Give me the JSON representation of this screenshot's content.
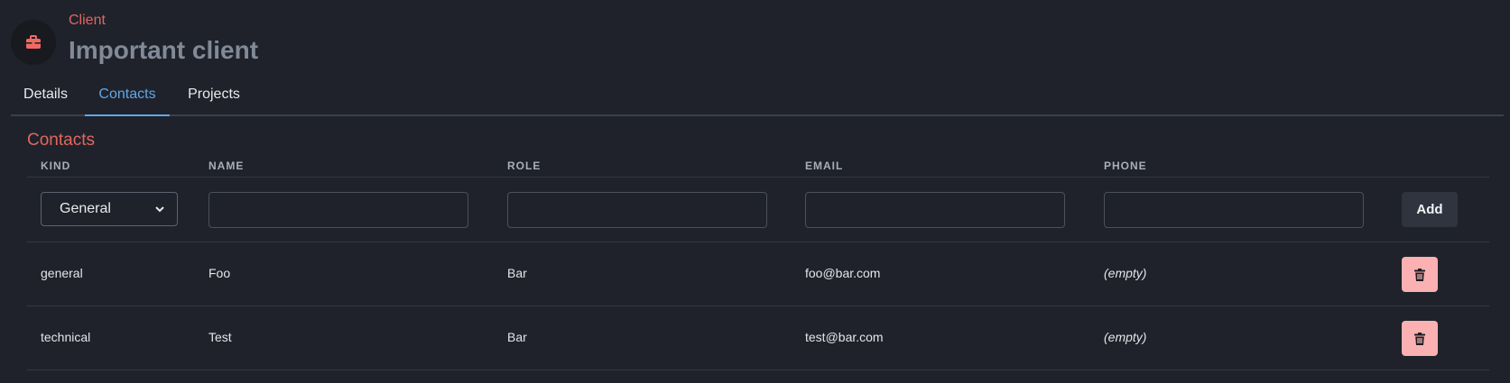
{
  "header": {
    "eyebrow": "Client",
    "title": "Important client",
    "icon": "briefcase-icon"
  },
  "tabs": [
    {
      "label": "Details",
      "active": false
    },
    {
      "label": "Contacts",
      "active": true
    },
    {
      "label": "Projects",
      "active": false
    }
  ],
  "section_title": "Contacts",
  "columns": [
    "KIND",
    "NAME",
    "ROLE",
    "EMAIL",
    "PHONE"
  ],
  "form": {
    "kind_selected": "General",
    "name_value": "",
    "role_value": "",
    "email_value": "",
    "phone_value": "",
    "add_label": "Add"
  },
  "rows": [
    {
      "kind": "general",
      "name": "Foo",
      "role": "Bar",
      "email": "foo@bar.com",
      "phone": "(empty)"
    },
    {
      "kind": "technical",
      "name": "Test",
      "role": "Bar",
      "email": "test@bar.com",
      "phone": "(empty)"
    }
  ],
  "colors": {
    "accent": "#e0675f",
    "active_tab": "#5fa8e8",
    "delete_button": "#fbb1b1",
    "background": "#1f222b"
  }
}
